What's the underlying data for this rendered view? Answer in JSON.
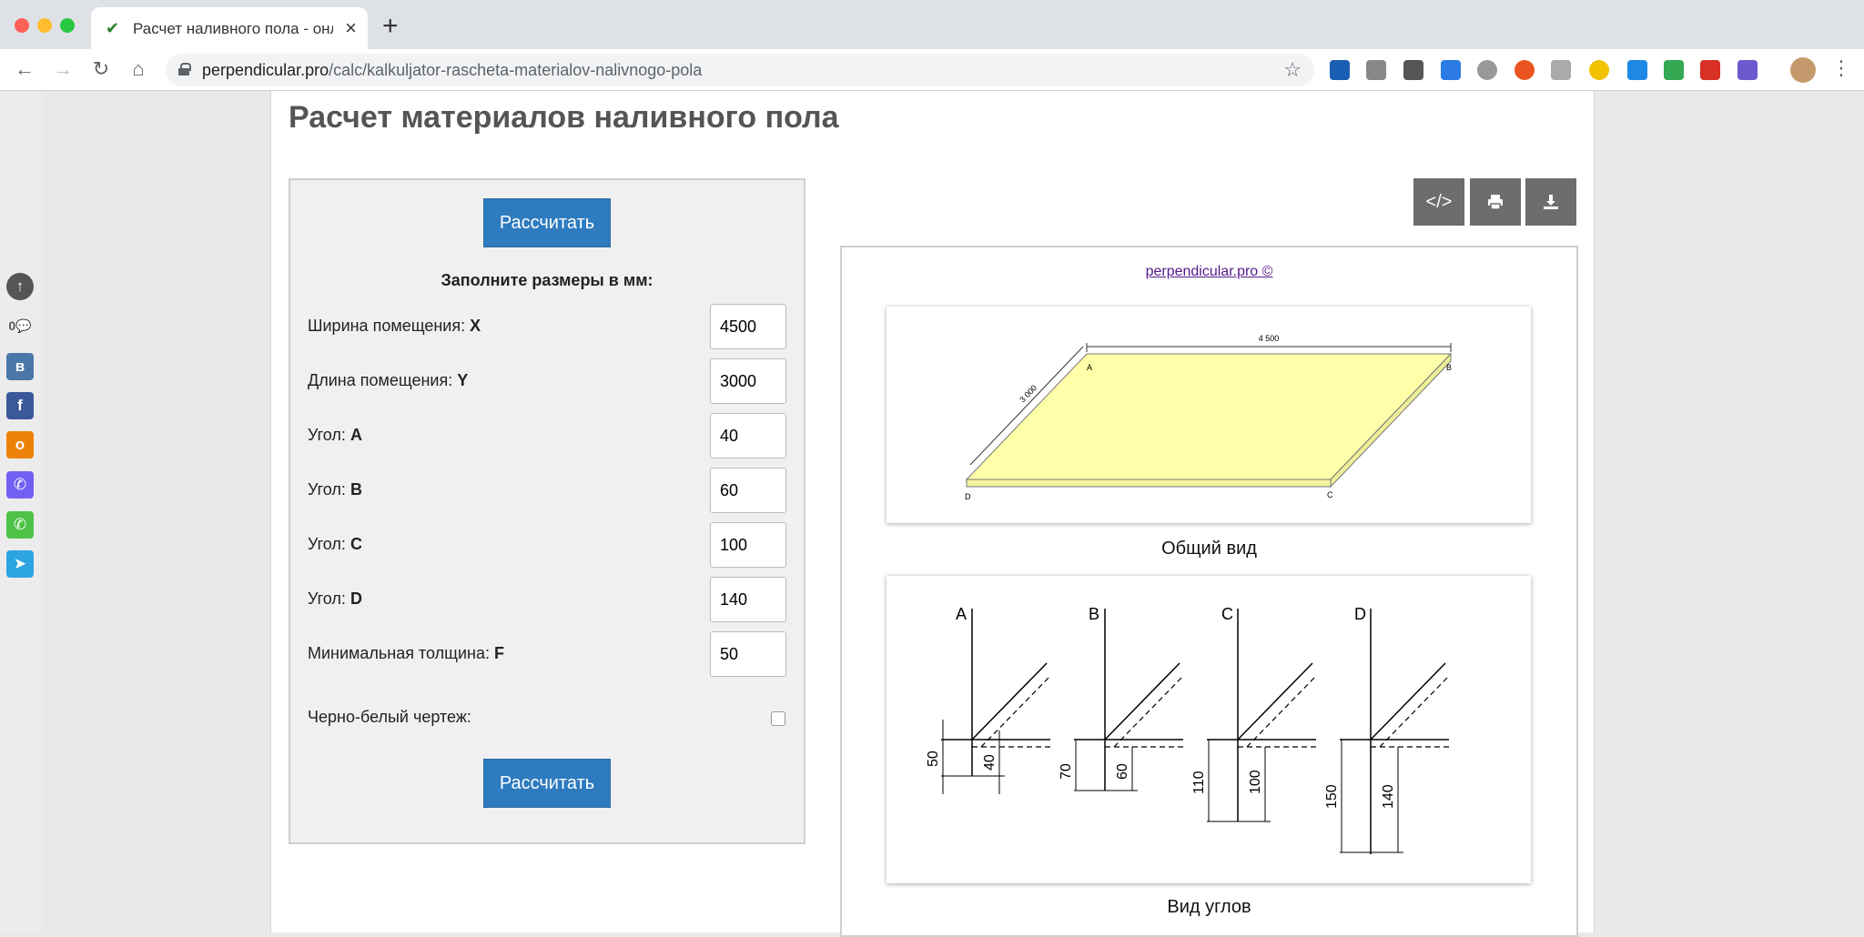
{
  "browser": {
    "tab_title": "Расчет наливного пола - онлайн",
    "new_tab": "+",
    "close": "×",
    "url_host": "perpendicular.pro",
    "url_path": "/calc/kalkuljator-rascheta-materialov-nalivnogo-pola"
  },
  "sidebar": {
    "comment_count": "0",
    "share_items": [
      "vk",
      "facebook",
      "odnoklassniki",
      "viber",
      "whatsapp",
      "telegram"
    ]
  },
  "page": {
    "title": "Расчет материалов наливного пола"
  },
  "form": {
    "calc_button_top": "Рассчитать",
    "calc_button_bottom": "Рассчитать",
    "heading": "Заполните размеры в мм:",
    "fields": [
      {
        "label": "Ширина помещения:",
        "key": "X",
        "value": "4500"
      },
      {
        "label": "Длина помещения:",
        "key": "Y",
        "value": "3000"
      },
      {
        "label": "Угол:",
        "key": "A",
        "value": "40"
      },
      {
        "label": "Угол:",
        "key": "B",
        "value": "60"
      },
      {
        "label": "Угол:",
        "key": "C",
        "value": "100"
      },
      {
        "label": "Угол:",
        "key": "D",
        "value": "140"
      },
      {
        "label": "Минимальная толщина:",
        "key": "F",
        "value": "50"
      }
    ],
    "bw_label": "Черно-белый чертеж:"
  },
  "tools": {
    "embed": "</>",
    "print": "print-icon",
    "download": "download-icon"
  },
  "drawing": {
    "copyright": "perpendicular.pro ©",
    "general_view": {
      "caption": "Общий вид",
      "width_dim": "4 500",
      "length_dim": "3 000",
      "corners": [
        "A",
        "B",
        "C",
        "D"
      ]
    },
    "angles_view": {
      "caption": "Вид углов",
      "groups": [
        {
          "corner": "A",
          "outer": "50",
          "inner": "40"
        },
        {
          "corner": "B",
          "outer": "70",
          "inner": "60"
        },
        {
          "corner": "C",
          "outer": "110",
          "inner": "100"
        },
        {
          "corner": "D",
          "outer": "150",
          "inner": "140"
        }
      ]
    }
  },
  "colors": {
    "primary_button": "#2e7bbf",
    "tool_button": "#6d6d6d",
    "floor_fill": "#ffffaa"
  }
}
